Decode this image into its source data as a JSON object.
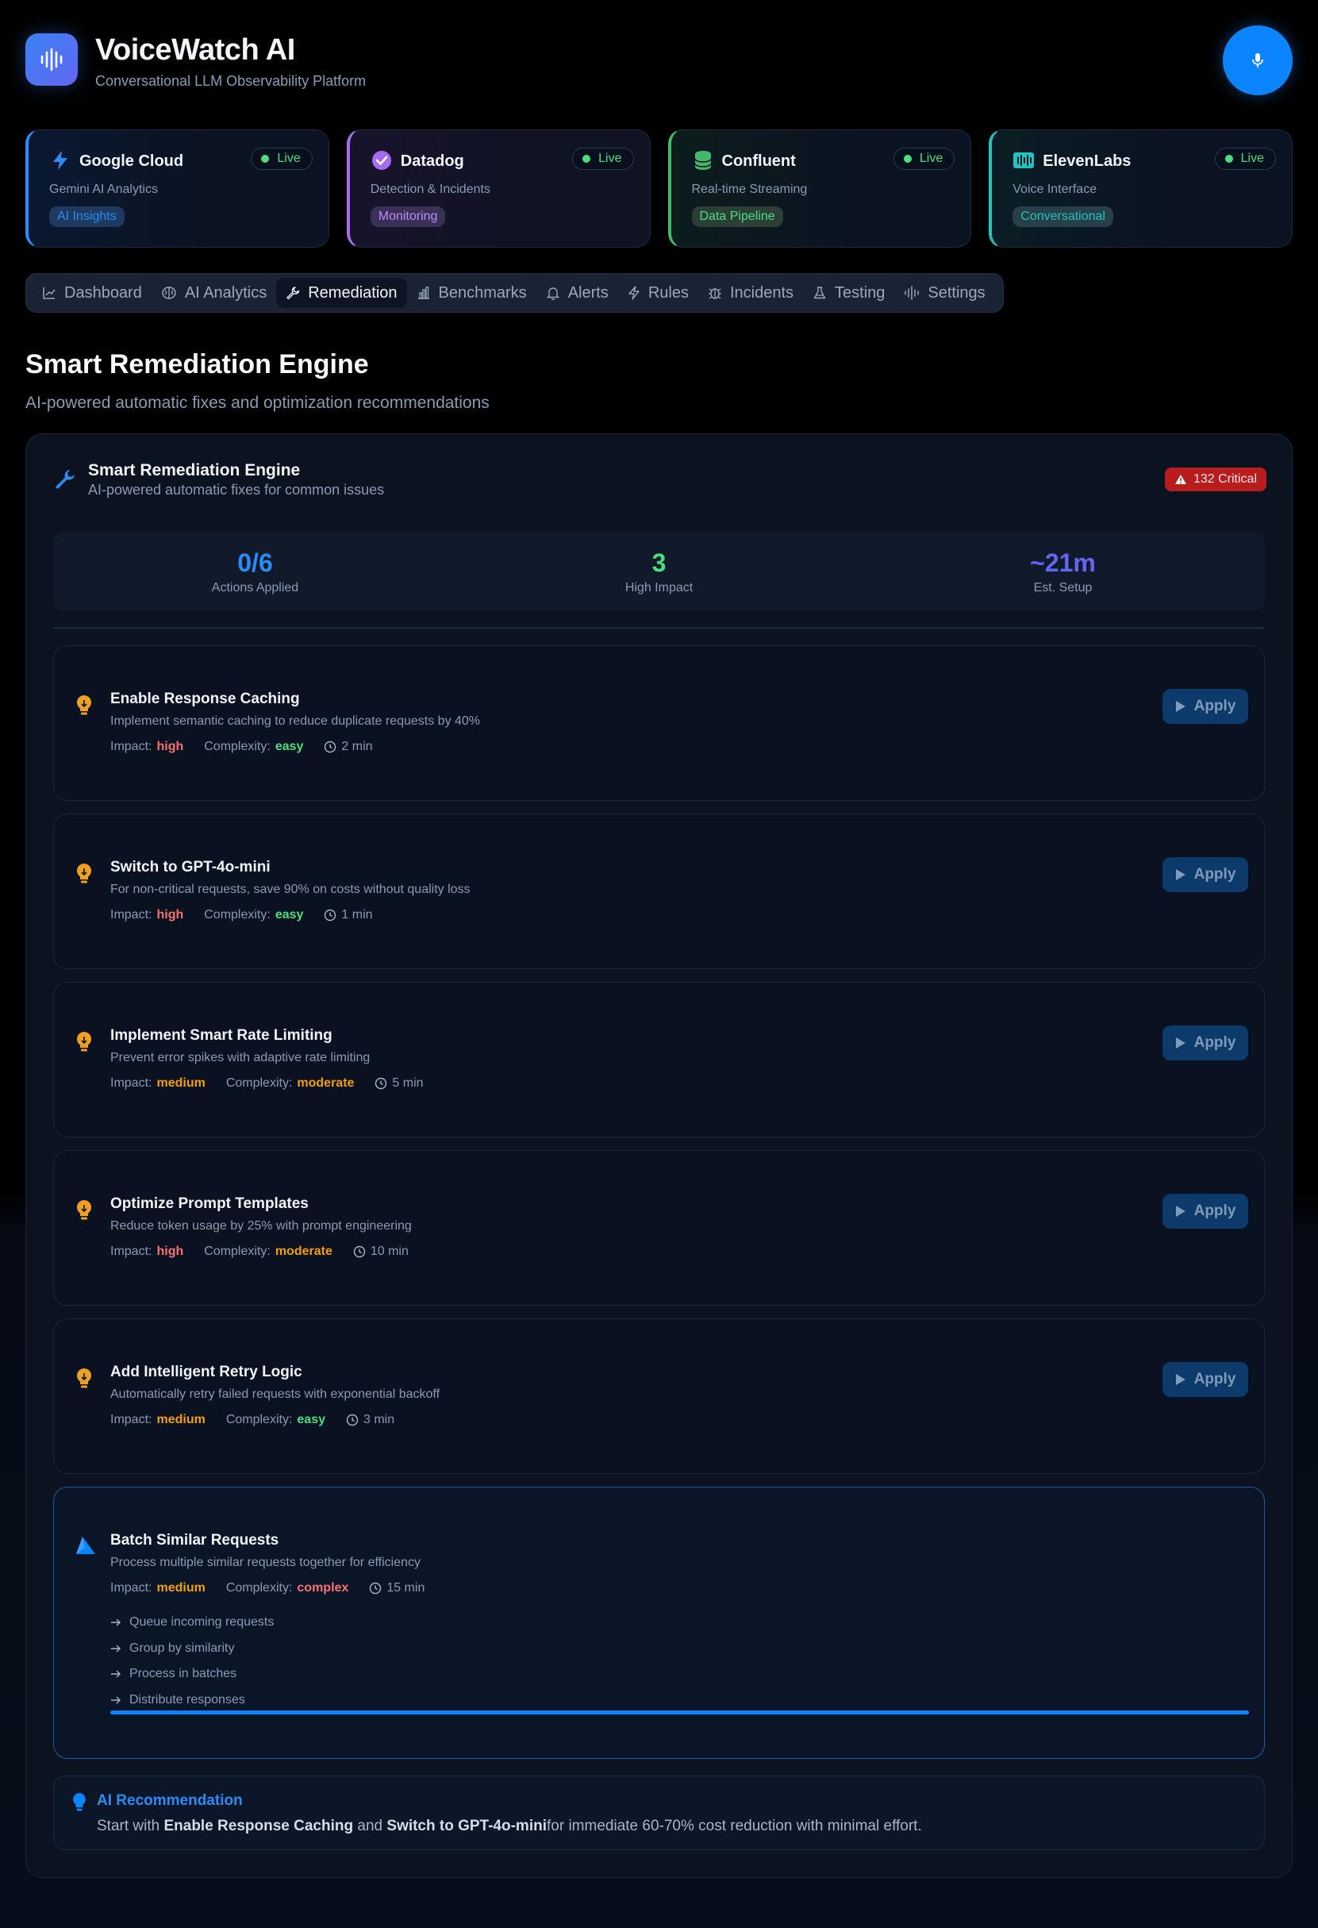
{
  "app": {
    "title": "VoiceWatch AI",
    "subtitle": "Conversational LLM Observability Platform"
  },
  "integrations": [
    {
      "name": "Google Cloud",
      "status": "Live",
      "description": "Gemini AI Analytics",
      "tag": "AI Insights",
      "accent": "#2b8cf7",
      "icon": "lightning-icon"
    },
    {
      "name": "Datadog",
      "status": "Live",
      "description": "Detection & Incidents",
      "tag": "Monitoring",
      "accent": "#a66cf0",
      "icon": "check-circle-icon"
    },
    {
      "name": "Confluent",
      "status": "Live",
      "description": "Real-time Streaming",
      "tag": "Data Pipeline",
      "accent": "#44b86a",
      "icon": "database-icon"
    },
    {
      "name": "ElevenLabs",
      "status": "Live",
      "description": "Voice Interface",
      "tag": "Conversational",
      "accent": "#22c4c0",
      "icon": "audio-wave-icon"
    }
  ],
  "nav": {
    "tabs": [
      {
        "label": "Dashboard",
        "icon": "chart-line-icon"
      },
      {
        "label": "AI Analytics",
        "icon": "brain-icon"
      },
      {
        "label": "Remediation",
        "icon": "wrench-icon",
        "active": true
      },
      {
        "label": "Benchmarks",
        "icon": "bar-chart-icon"
      },
      {
        "label": "Alerts",
        "icon": "bell-icon"
      },
      {
        "label": "Rules",
        "icon": "lightning-icon"
      },
      {
        "label": "Incidents",
        "icon": "bug-icon"
      },
      {
        "label": "Testing",
        "icon": "flask-icon"
      },
      {
        "label": "Settings",
        "icon": "audio-bars-icon"
      }
    ]
  },
  "page": {
    "title": "Smart Remediation Engine",
    "subtitle": "AI-powered automatic fixes and optimization recommendations"
  },
  "panel": {
    "title": "Smart Remediation Engine",
    "subtitle": "AI-powered automatic fixes for common issues",
    "critical_badge": "132 Critical",
    "stats": [
      {
        "value": "0/6",
        "label": "Actions Applied",
        "color": "#2b8cf7"
      },
      {
        "value": "3",
        "label": "High Impact",
        "color": "#4ade80"
      },
      {
        "value": "~21m",
        "label": "Est. Setup",
        "color": "#6366f1"
      }
    ],
    "meta_labels": {
      "impact": "Impact:",
      "complexity": "Complexity:"
    },
    "apply_label": "Apply",
    "actions": [
      {
        "title": "Enable Response Caching",
        "description": "Implement semantic caching to reduce duplicate requests by 40%",
        "impact": "high",
        "complexity": "easy",
        "time": "2 min"
      },
      {
        "title": "Switch to GPT-4o-mini",
        "description": "For non-critical requests, save 90% on costs without quality loss",
        "impact": "high",
        "complexity": "easy",
        "time": "1 min"
      },
      {
        "title": "Implement Smart Rate Limiting",
        "description": "Prevent error spikes with adaptive rate limiting",
        "impact": "medium",
        "complexity": "moderate",
        "time": "5 min"
      },
      {
        "title": "Optimize Prompt Templates",
        "description": "Reduce token usage by 25% with prompt engineering",
        "impact": "high",
        "complexity": "moderate",
        "time": "10 min"
      },
      {
        "title": "Add Intelligent Retry Logic",
        "description": "Automatically retry failed requests with exponential backoff",
        "impact": "medium",
        "complexity": "easy",
        "time": "3 min"
      },
      {
        "title": "Batch Similar Requests",
        "description": "Process multiple similar requests together for efficiency",
        "impact": "medium",
        "complexity": "complex",
        "time": "15 min",
        "steps": [
          "Queue incoming requests",
          "Group by similarity",
          "Process in batches",
          "Distribute responses"
        ],
        "progress": 1.0
      }
    ],
    "recommendation": {
      "title": "AI Recommendation",
      "prefix": "Start with ",
      "first": "Enable Response Caching",
      "middle": " and ",
      "second": "Switch to GPT-4o-mini",
      "suffix": "for immediate 60-70% cost reduction with minimal effort."
    }
  }
}
